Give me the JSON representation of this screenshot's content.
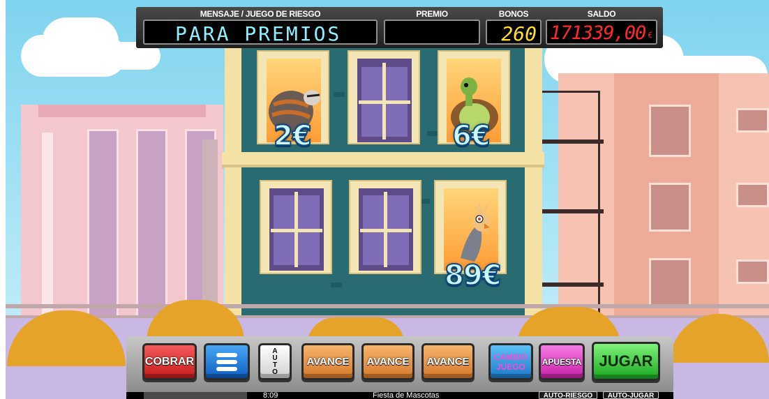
{
  "top_panel": {
    "message_label": "MENSAJE / JUEGO DE RIESGO",
    "message_value": "PARA PREMIOS",
    "prize_label": "PREMIO",
    "prize_value": "",
    "bonus_label": "BONOS",
    "bonus_value": "260",
    "balance_label": "SALDO",
    "balance_value": "171339,00",
    "currency_symbol": "€"
  },
  "windows": {
    "top_left_prize": "2€",
    "top_right_prize": "6€",
    "bottom_right_prize": "89€",
    "top_left_character": "raccoon-icon",
    "top_right_character": "turtle-icon",
    "bottom_right_character": "parrot-icon"
  },
  "buttons": {
    "collect": "COBRAR",
    "menu_icon": "menu-icon",
    "auto_letters": [
      "A",
      "U",
      "T",
      "O"
    ],
    "advance_1": "AVANCE",
    "advance_2": "AVANCE",
    "advance_3": "AVANCE",
    "change_game_1": "CAMBIO",
    "change_game_2": "JUEGO",
    "bet": "APUESTA",
    "play": "JUGAR"
  },
  "status_bar": {
    "time": "8:09",
    "game_name": "Fiesta de Mascotas",
    "auto_risk": "AUTO-RIESGO",
    "auto_play": "AUTO-JUGAR"
  },
  "colors": {
    "lcd_message": "#8ff0ff",
    "lcd_bonus": "#ffe02a",
    "lcd_balance": "#ff2a2a",
    "building_teal": "#2a6b72",
    "prize_fill": "#cff6ff"
  }
}
